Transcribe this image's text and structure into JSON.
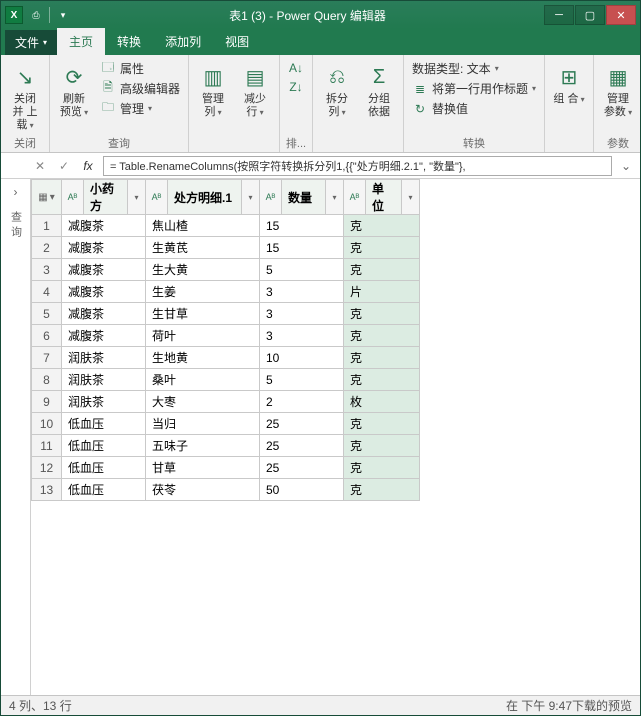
{
  "window": {
    "title": "表1 (3) - Power Query 编辑器"
  },
  "tabs": {
    "file": "文件",
    "home": "主页",
    "transform": "转换",
    "addcol": "添加列",
    "view": "视图"
  },
  "ribbon": {
    "close": {
      "closeLoad": "关闭并\n上载",
      "group": "关闭"
    },
    "query": {
      "refresh": "刷新\n预览",
      "props": "属性",
      "advEditor": "高级编辑器",
      "manage": "管理",
      "group": "查询"
    },
    "mgmtCols": {
      "cols": "管理\n列",
      "rows": "减少\n行",
      "group": ""
    },
    "sort": {
      "group": "排..."
    },
    "split": {
      "split": "拆分\n列",
      "groupby": "分组\n依据"
    },
    "transform": {
      "datatype": "数据类型: 文本",
      "firstrow": "将第一行用作标题",
      "replace": "替换值",
      "group": "转换"
    },
    "combine": {
      "lbl": "组\n合",
      "group": ""
    },
    "params": {
      "lbl": "管理\n参数",
      "group": "参数"
    }
  },
  "formula": "= Table.RenameColumns(按照字符转换拆分列1,{{\"处方明细.2.1\", \"数量\"},",
  "sidepanel": "查询",
  "columns": {
    "c1": "小药方",
    "c2": "处方明细.1",
    "c3": "数量",
    "c4": "单位"
  },
  "rows": [
    {
      "n": "1",
      "a": "减腹茶",
      "b": "焦山楂",
      "c": "15",
      "d": "克"
    },
    {
      "n": "2",
      "a": "减腹茶",
      "b": "生黄芪",
      "c": "15",
      "d": "克"
    },
    {
      "n": "3",
      "a": "减腹茶",
      "b": "生大黄",
      "c": "5",
      "d": "克"
    },
    {
      "n": "4",
      "a": "减腹茶",
      "b": "生姜",
      "c": "3",
      "d": "片"
    },
    {
      "n": "5",
      "a": "减腹茶",
      "b": "生甘草",
      "c": "3",
      "d": "克"
    },
    {
      "n": "6",
      "a": "减腹茶",
      "b": "荷叶",
      "c": "3",
      "d": "克"
    },
    {
      "n": "7",
      "a": "润肤茶",
      "b": "生地黄",
      "c": "10",
      "d": "克"
    },
    {
      "n": "8",
      "a": "润肤茶",
      "b": "桑叶",
      "c": "5",
      "d": "克"
    },
    {
      "n": "9",
      "a": "润肤茶",
      "b": "大枣",
      "c": "2",
      "d": "枚"
    },
    {
      "n": "10",
      "a": "低血压",
      "b": "当归",
      "c": "25",
      "d": "克"
    },
    {
      "n": "11",
      "a": "低血压",
      "b": "五味子",
      "c": "25",
      "d": "克"
    },
    {
      "n": "12",
      "a": "低血压",
      "b": "甘草",
      "c": "25",
      "d": "克"
    },
    {
      "n": "13",
      "a": "低血压",
      "b": "茯苓",
      "c": "50",
      "d": "克"
    }
  ],
  "status": {
    "left": "4 列、13 行",
    "right": "在 下午 9:47下载的预览"
  }
}
